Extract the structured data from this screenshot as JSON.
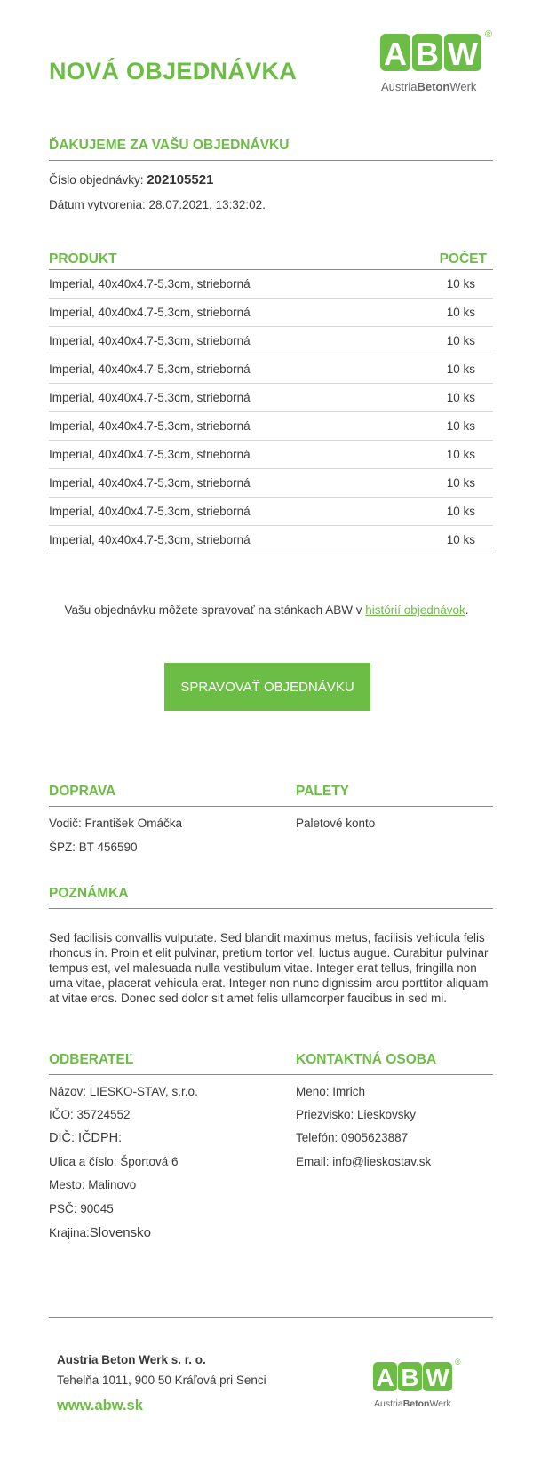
{
  "header": {
    "title": "NOVÁ OBJEDNÁVKA"
  },
  "brand": {
    "logo_text": "ABW",
    "logo_sub_1": "Austria",
    "logo_sub_2": "Beton",
    "logo_sub_3": "Werk",
    "registered": "®",
    "accent": "#6cbd45"
  },
  "thanks": {
    "heading": "ĎAKUJEME ZA VAŠU OBJEDNÁVKU",
    "order_label": "Číslo objednávky:",
    "order_number": "202105521",
    "created": "Dátum vytvorenia: 28.07.2021, 13:32:02."
  },
  "products": {
    "col_product": "PRODUKT",
    "col_count": "POČET",
    "items": [
      {
        "name": "Imperial, 40x40x4.7-5.3cm, strieborná",
        "qty": "10 ks"
      },
      {
        "name": "Imperial, 40x40x4.7-5.3cm, strieborná",
        "qty": "10 ks"
      },
      {
        "name": "Imperial, 40x40x4.7-5.3cm, strieborná",
        "qty": "10 ks"
      },
      {
        "name": "Imperial, 40x40x4.7-5.3cm, strieborná",
        "qty": "10 ks"
      },
      {
        "name": "Imperial, 40x40x4.7-5.3cm, strieborná",
        "qty": "10 ks"
      },
      {
        "name": "Imperial, 40x40x4.7-5.3cm, strieborná",
        "qty": "10 ks"
      },
      {
        "name": "Imperial, 40x40x4.7-5.3cm, strieborná",
        "qty": "10 ks"
      },
      {
        "name": "Imperial, 40x40x4.7-5.3cm, strieborná",
        "qty": "10 ks"
      },
      {
        "name": "Imperial, 40x40x4.7-5.3cm, strieborná",
        "qty": "10 ks"
      },
      {
        "name": "Imperial, 40x40x4.7-5.3cm, strieborná",
        "qty": "10 ks"
      }
    ]
  },
  "manage": {
    "text_before": "Vašu objednávku môžete spravovať na stánkach ABW v ",
    "link": "histórií objednávok",
    "text_after": ".",
    "button": "SPRAVOVAŤ OBJEDNÁVKU"
  },
  "transport": {
    "heading": "DOPRAVA",
    "driver": "Vodič: František Omáčka",
    "plate": "ŠPZ: BT 456590"
  },
  "pallets": {
    "heading": "PALETY",
    "text": "Paletové konto"
  },
  "note": {
    "heading": "POZNÁMKA",
    "text": "Sed facilisis convallis vulputate. Sed blandit maximus metus, facilisis vehicula felis rhoncus in. Proin et elit pulvinar, pretium tortor vel, luctus augue. Curabitur pulvinar tempus est, vel malesuada nulla vestibulum vitae. Integer erat tellus, fringilla non urna vitae, placerat vehicula erat. Integer non nunc dignissim arcu porttitor aliquam at vitae eros. Donec sed dolor sit amet felis ullamcorper faucibus in sed mi."
  },
  "customer": {
    "heading": "ODBERATEĽ",
    "name": "Názov: LIESKO-STAV, s.r.o.",
    "ico": "IČO: 35724552",
    "dic": "DIČ: IČDPH:",
    "street": "Ulica a číslo: Športová 6",
    "city": "Mesto: Malinovo",
    "zip": "PSČ: 90045",
    "country_label": "Krajina:",
    "country": "Slovensko"
  },
  "contact": {
    "heading": "KONTAKTNÁ OSOBA",
    "first": "Meno: Imrich",
    "last": "Priezvisko: Lieskovsky",
    "phone": "Telefón:  0905623887",
    "email": "Email: info@lieskostav.sk"
  },
  "footer": {
    "company": "Austria Beton Werk s. r. o.",
    "address": "Tehelňa 1011, 900 50 Kráľová pri Senci",
    "web": "www.abw.sk"
  }
}
